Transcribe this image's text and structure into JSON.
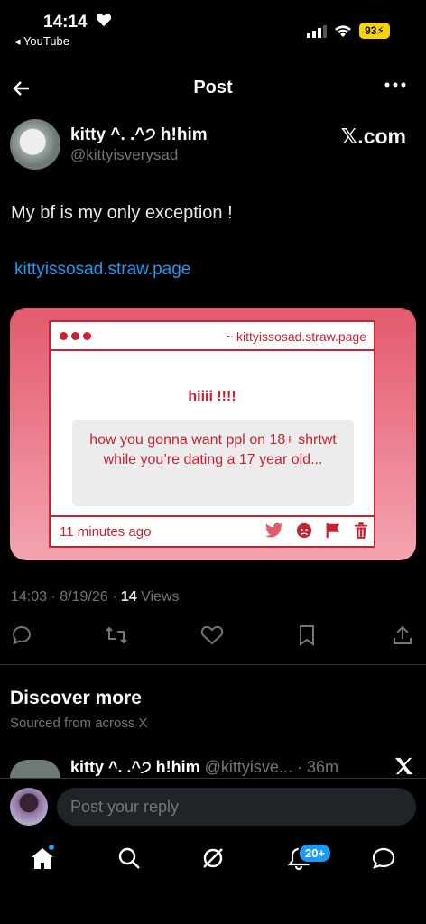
{
  "status": {
    "time": "14:14",
    "back_app": "◂ YouTube",
    "battery": "93"
  },
  "header": {
    "title": "Post"
  },
  "post": {
    "author_name": "kitty ^. .^੭ h!him",
    "author_handle": "@kittyisverysad",
    "source": "𝕏.com",
    "text": "My bf is my only exception !",
    "link": "kittyissosad.straw.page",
    "timestamp": "14:03 · 8/19/26 · ",
    "views_count": "14",
    "views_label": " Views"
  },
  "card": {
    "url": "~ kittyissosad.straw.page",
    "greeting": "hiiii !!!!",
    "message": "how you gonna want ppl on 18+ shrtwt while you’re dating a 17 year old...",
    "time_ago": "11 minutes ago",
    "color": "#c62234"
  },
  "discover": {
    "title": "Discover more",
    "subtitle": "Sourced from across X",
    "item": {
      "name": "kitty ^. .^੭ h!him",
      "handle_time": "@kittyisve... · 36m"
    }
  },
  "reply": {
    "placeholder": "Post your reply"
  },
  "tabbar": {
    "notifications_badge": "20+"
  },
  "icons": [
    "heart-icon",
    "signal-icon",
    "wifi-icon",
    "battery-icon",
    "back-arrow-icon",
    "more-icon",
    "reply-icon",
    "repost-icon",
    "like-icon",
    "bookmark-icon",
    "share-icon",
    "twitter-icon",
    "angry-icon",
    "flag-icon",
    "trash-icon",
    "x-logo-icon",
    "home-icon",
    "search-icon",
    "grok-icon",
    "bell-icon",
    "messages-icon"
  ]
}
